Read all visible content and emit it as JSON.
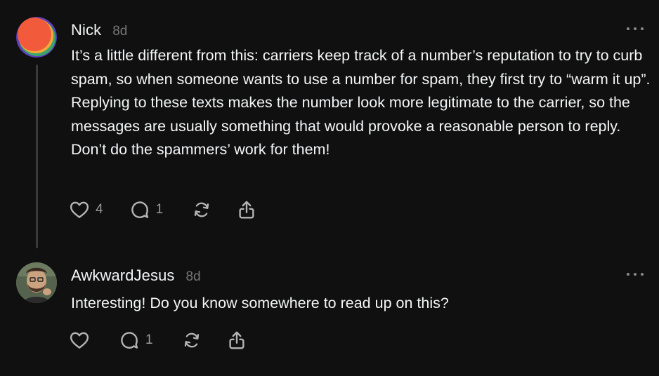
{
  "posts": [
    {
      "username": "Nick",
      "time": "8d",
      "text": "It’s a little different from this: carriers keep track of a number’s reputation to try to curb spam, so when someone wants to use a number for spam, they first try to “warm it up”. Replying to these texts makes the number look more legitimate to the carrier, so the messages are usually something that would provoke a reasonable person to reply. Don’t do the spammers’ work for them!",
      "likes": "4",
      "replies": "1",
      "avatar_colors": [
        "#f15a3a",
        "#f6a93b",
        "#3aa768",
        "#5b3fbf"
      ]
    },
    {
      "username": "AwkwardJesus",
      "time": "8d",
      "text": "Interesting! Do you know somewhere to read up on this?",
      "likes": "",
      "replies": "1"
    }
  ],
  "icons": {
    "like": "heart-icon",
    "reply": "comment-icon",
    "repost": "repost-icon",
    "share": "share-icon",
    "more": "more-icon"
  }
}
